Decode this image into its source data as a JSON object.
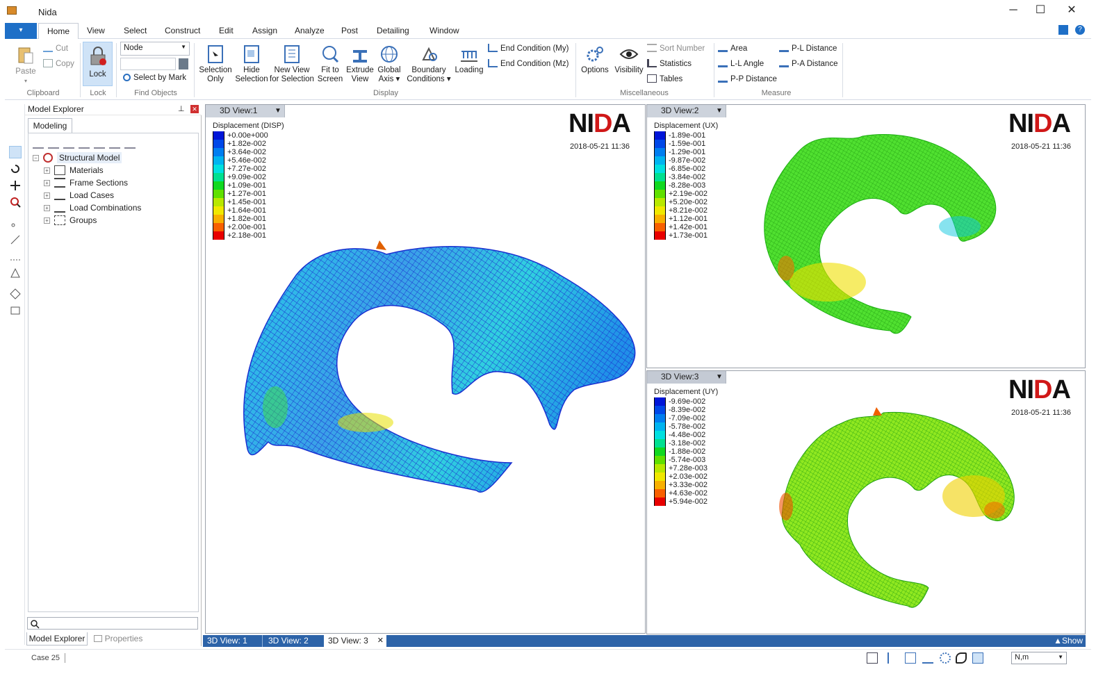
{
  "window": {
    "title": "Nida",
    "minimize": "─",
    "maximize": "☐",
    "close": "✕"
  },
  "menu": {
    "app_button": "▾",
    "tabs": [
      "Home",
      "View",
      "Select",
      "Construct",
      "Edit",
      "Assign",
      "Analyze",
      "Post",
      "Detailing",
      "Window"
    ]
  },
  "ribbon": {
    "clipboard": {
      "paste": "Paste",
      "cut": "Cut",
      "copy": "Copy",
      "label": "Clipboard"
    },
    "lock": {
      "lock": "Lock",
      "label": "Lock"
    },
    "find": {
      "combo_value": "Node",
      "select_by_mark": "Select by Mark",
      "label": "Find Objects"
    },
    "display": {
      "selection_only": [
        "Selection",
        "Only"
      ],
      "hide_selection": [
        "Hide",
        "Selection"
      ],
      "new_view": [
        "New View",
        "for Selection"
      ],
      "fit": [
        "Fit to",
        "Screen"
      ],
      "extrude": [
        "Extrude",
        "View"
      ],
      "global_axis": [
        "Global",
        "Axis ▾"
      ],
      "boundary": [
        "Boundary",
        "Conditions ▾"
      ],
      "loading": "Loading",
      "end_my": "End Condition (My)",
      "end_mz": "End Condition (Mz)",
      "label": "Display"
    },
    "misc": {
      "options": "Options",
      "visibility": "Visibility",
      "sort_number": "Sort Number",
      "statistics": "Statistics",
      "tables": "Tables",
      "label": "Miscellaneous"
    },
    "measure": {
      "area": "Area",
      "ll_angle": "L-L Angle",
      "pp_distance": "P-P Distance",
      "pl_distance": "P-L Distance",
      "pa_distance": "P-A Distance",
      "label": "Measure"
    }
  },
  "explorer": {
    "title": "Model Explorer",
    "pin": "⊥",
    "close": "✕",
    "tab": "Modeling",
    "root": "Structural Model",
    "items": [
      "Materials",
      "Frame Sections",
      "Load Cases",
      "Load Combinations",
      "Groups"
    ],
    "bottom_tabs": [
      "Model Explorer",
      "Properties"
    ]
  },
  "views": [
    {
      "tab": "3D View:1",
      "legend_title": "Displacement (DISP)",
      "date": "2018-05-21 11:36",
      "values": [
        "+0.00e+000",
        "+1.82e-002",
        "+3.64e-002",
        "+5.46e-002",
        "+7.27e-002",
        "+9.09e-002",
        "+1.09e-001",
        "+1.27e-001",
        "+1.45e-001",
        "+1.64e-001",
        "+1.82e-001",
        "+2.00e-001",
        "+2.18e-001"
      ]
    },
    {
      "tab": "3D View:2",
      "legend_title": "Displacement (UX)",
      "date": "2018-05-21 11:36",
      "values": [
        "-1.89e-001",
        "-1.59e-001",
        "-1.29e-001",
        "-9.87e-002",
        "-6.85e-002",
        "-3.84e-002",
        "-8.28e-003",
        "+2.19e-002",
        "+5.20e-002",
        "+8.21e-002",
        "+1.12e-001",
        "+1.42e-001",
        "+1.73e-001"
      ]
    },
    {
      "tab": "3D View:3",
      "legend_title": "Displacement (UY)",
      "date": "2018-05-21 11:36",
      "values": [
        "-9.69e-002",
        "-8.39e-002",
        "-7.09e-002",
        "-5.78e-002",
        "-4.48e-002",
        "-3.18e-002",
        "-1.88e-002",
        "-5.74e-003",
        "+7.28e-003",
        "+2.03e-002",
        "+3.33e-002",
        "+4.63e-002",
        "+5.94e-002"
      ]
    }
  ],
  "logo": {
    "left": "NI",
    "middle": "D",
    "right": "A"
  },
  "legend_colors": [
    "#0016d8",
    "#0048e8",
    "#007ef0",
    "#00b4f0",
    "#00e0e0",
    "#00e090",
    "#10d820",
    "#60e000",
    "#b8e800",
    "#f0e800",
    "#f8b000",
    "#f86000",
    "#e80000"
  ],
  "doc_tabs": {
    "tab1": "3D View: 1",
    "tab2": "3D View: 2",
    "active": "3D View: 3",
    "close": "✕",
    "show": "▲Show"
  },
  "status": {
    "case": "Case 25",
    "units": "N,m"
  }
}
